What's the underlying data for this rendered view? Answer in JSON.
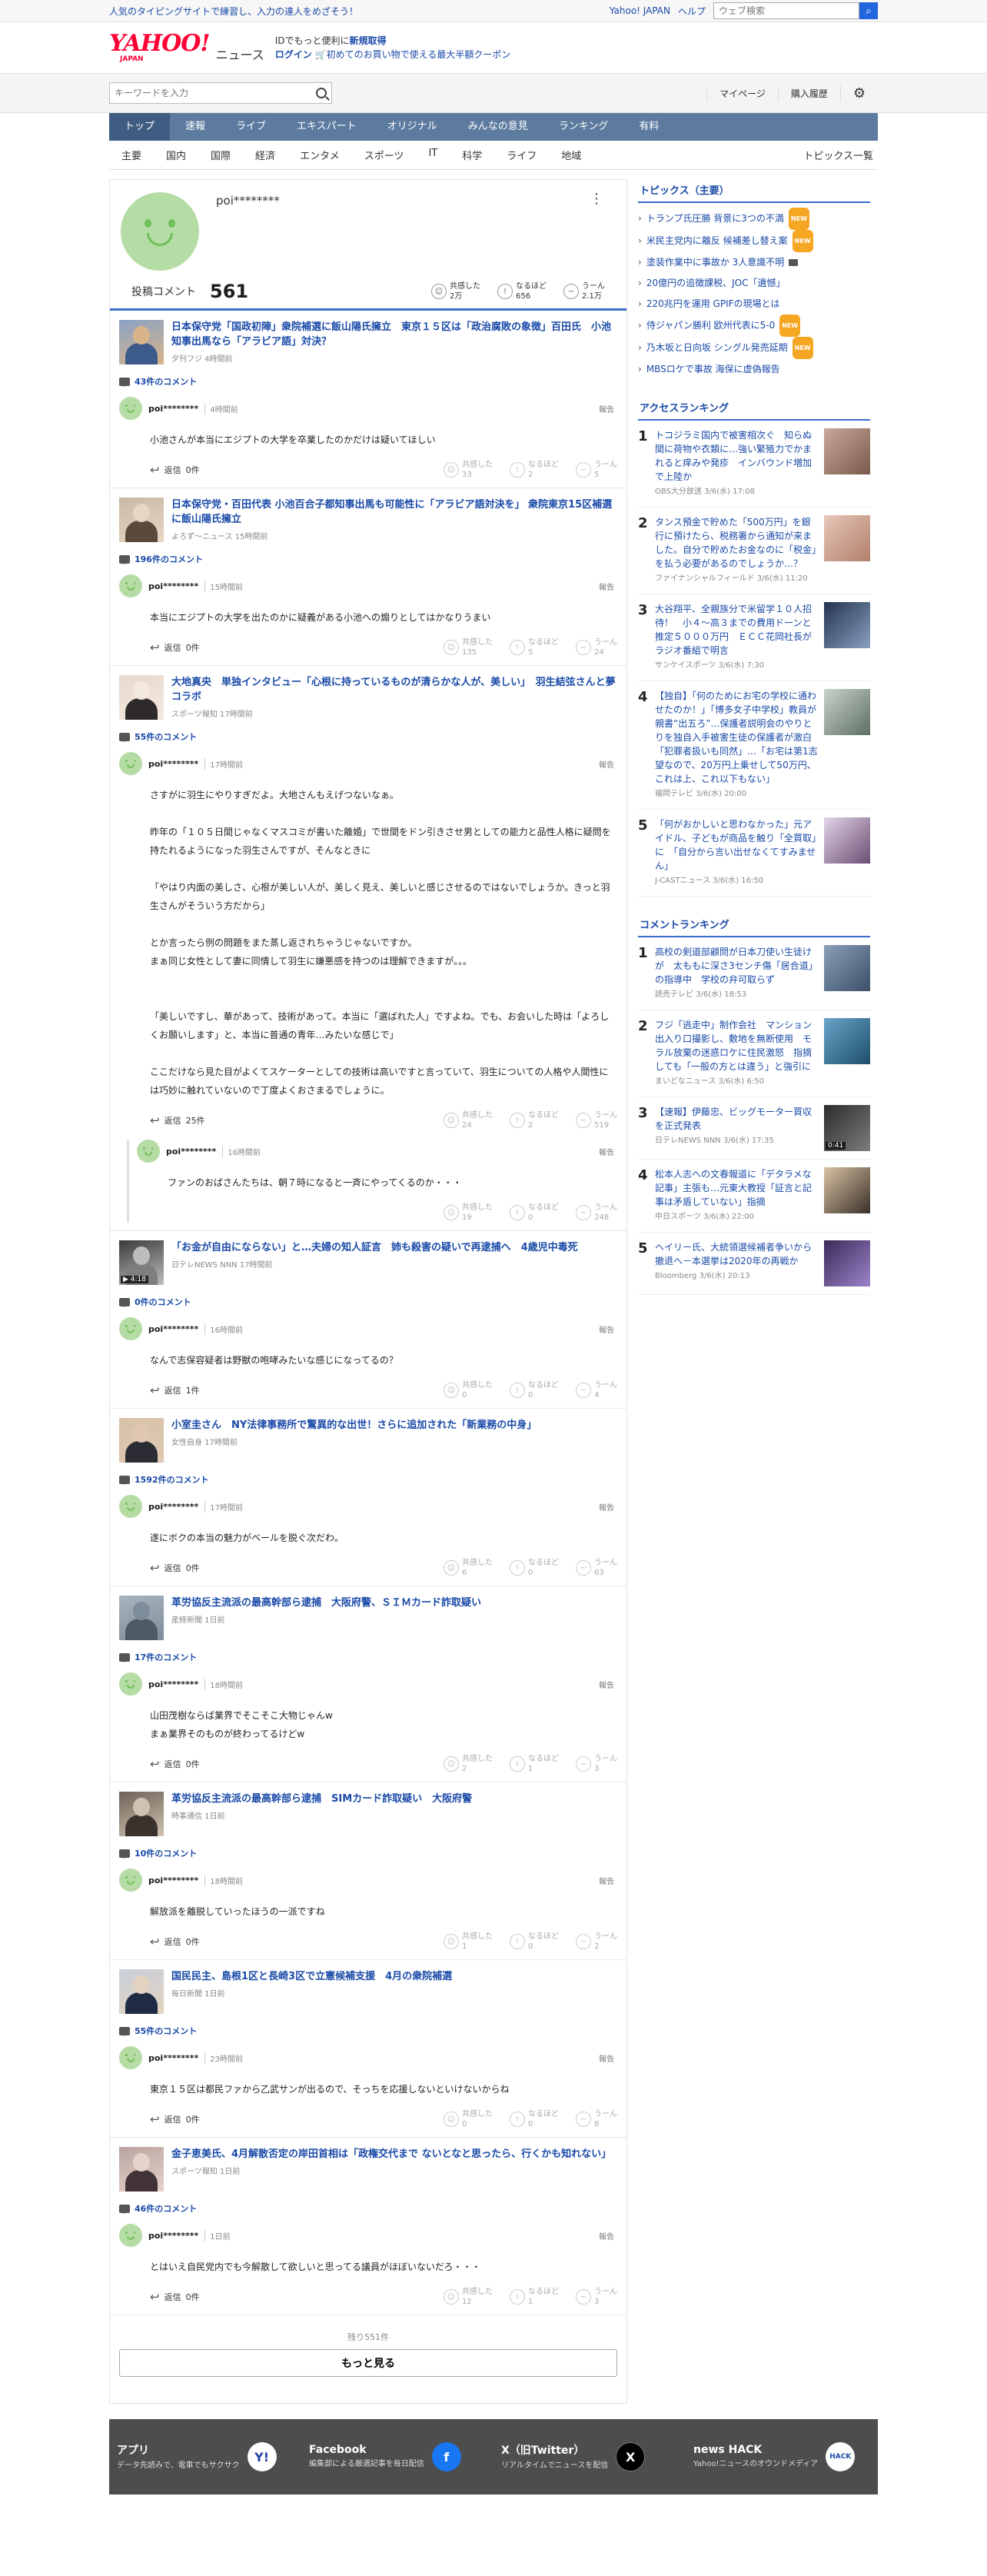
{
  "header": {
    "tagline": "人気のタイピングサイトで練習し、入力の達人をめざそう！",
    "links": [
      "Yahoo! JAPAN",
      "ヘルプ"
    ],
    "web_search_placeholder": "ウェブ検索",
    "logo_text": "YAHOO!",
    "logo_sub": "JAPAN",
    "logo_news": "ニュース",
    "promo_line1_a": "IDでもっと便利に",
    "promo_line1_b": "新規取得",
    "promo_login": "ログイン",
    "promo_line2": "初めてのお買い物で使える最大半額クーポン",
    "keyword_placeholder": "キーワードを入力",
    "mypage": "マイページ",
    "purchase": "購入履歴"
  },
  "gnav": [
    "トップ",
    "速報",
    "ライブ",
    "エキスパート",
    "オリジナル",
    "みんなの意見",
    "ランキング",
    "有料"
  ],
  "subnav": [
    "主要",
    "国内",
    "国際",
    "経済",
    "エンタメ",
    "スポーツ",
    "IT",
    "科学",
    "ライフ",
    "地域"
  ],
  "subnav_all": "トピックス一覧",
  "profile": {
    "name": "poi********",
    "kebab": "⋮",
    "count_label": "投稿コメント",
    "count": "561",
    "reactions": [
      {
        "label": "共感した",
        "value": "2万"
      },
      {
        "label": "なるほど",
        "value": "656"
      },
      {
        "label": "うーん",
        "value": "2.1万"
      }
    ]
  },
  "reply_prefix": "返信",
  "report": "報告",
  "react_labels": [
    "共感した",
    "なるほど",
    "うーん"
  ],
  "entries": [
    {
      "title": "日本保守党「国政初陣」衆院補選に飯山陽氏擁立　東京１５区は「政治腐敗の象徴」百田氏　小池知事出馬なら「アラビア語」対決？",
      "meta": "夕刊フジ 4時間前",
      "ccount": "43件のコメント",
      "comments": [
        {
          "name": "poi********",
          "time": "4時間前",
          "body": "小池さんが本当にエジプトの大学を卒業したのかだけは疑いてほしい",
          "reply": "0件",
          "r": [
            "33",
            "2",
            "5"
          ]
        }
      ]
    },
    {
      "title": "日本保守党・百田代表 小池百合子都知事出馬も可能性に「アラビア語対決を」 衆院東京15区補選に飯山陽氏擁立",
      "meta": "よろず～ニュース 15時間前",
      "ccount": "196件のコメント",
      "comments": [
        {
          "name": "poi********",
          "time": "15時間前",
          "body": "本当にエジプトの大学を出たのかに疑義がある小池への煽りとしてはかなりうまい",
          "reply": "0件",
          "r": [
            "135",
            "5",
            "24"
          ]
        }
      ]
    },
    {
      "title": "大地真央　単独インタビュー「心根に持っているものが清らかな人が、美しい」　羽生結弦さんと夢コラボ",
      "meta": "スポーツ報知 17時間前",
      "ccount": "55件のコメント",
      "comments": [
        {
          "name": "poi********",
          "time": "17時間前",
          "body": "さすがに羽生にやりすぎだよ。大地さんもえげつないなぁ。\n\n昨年の「１０５日間じゃなくマスコミが書いた離婚」で世間をドン引きさせ男としての能力と品性人格に疑問を持たれるようになった羽生さんですが、そんなときに\n\n「やはり内面の美しさ、心根が美しい人が、美しく見え、美しいと感じさせるのではないでしょうか。きっと羽生さんがそういう方だから」\n\nとか言ったら例の問題をまた蒸し返されちゃうじゃないですか。\nまぁ同じ女性として妻に同情して羽生に嫌悪感を持つのは理解できますが。。。\n\n\n「美しいですし、華があって、技術があって。本当に「選ばれた人」ですよね。でも、お会いした時は「よろしくお願いします」と、本当に普通の青年…みたいな感じで」\n\nここだけなら見た目がよくてスケーターとしての技術は高いですと言っていて、羽生についての人格や人間性には巧妙に触れていないので丁度よくおさまるでしょうに。",
          "reply": "25件",
          "r": [
            "24",
            "2",
            "519"
          ]
        },
        {
          "name": "poi********",
          "time": "16時間前",
          "body": "ファンのおばさんたちは、朝７時になると一斉にやってくるのか・・・",
          "reply": null,
          "r": [
            "19",
            "0",
            "248"
          ],
          "thread": true
        }
      ]
    },
    {
      "title": "「お金が自由にならない」と…夫婦の知人証言　姉も殺害の疑いで再逮捕へ　4歳児中毒死",
      "meta": "日テレNEWS NNN 17時間前",
      "ccount": "0件のコメント",
      "video": "4:18",
      "comments": [
        {
          "name": "poi********",
          "time": "16時間前",
          "body": "なんで志保容疑者は野獣の咆哮みたいな感じになってるの？",
          "reply": "1件",
          "r": [
            "0",
            "0",
            "4"
          ]
        }
      ]
    },
    {
      "title": "小室圭さん　NY法律事務所で驚異的な出世！さらに追加された「新業務の中身」",
      "meta": "女性自身 17時間前",
      "ccount": "1592件のコメント",
      "comments": [
        {
          "name": "poi********",
          "time": "17時間前",
          "body": "遂にボクの本当の魅力がベールを脱ぐ次だわ。",
          "reply": "0件",
          "r": [
            "6",
            "0",
            "63"
          ]
        }
      ]
    },
    {
      "title": "革労協反主流派の最高幹部ら逮捕　大阪府警、ＳＩＭカード詐取疑い",
      "meta": "産経新聞 1日前",
      "ccount": "17件のコメント",
      "comments": [
        {
          "name": "poi********",
          "time": "18時間前",
          "body": "山田茂樹ならば業界でそこそこ大物じゃんw\nまぁ業界そのものが終わってるけどw",
          "reply": "0件",
          "r": [
            "2",
            "1",
            "3"
          ]
        }
      ]
    },
    {
      "title": "革労協反主流派の最高幹部ら逮捕　SIMカード詐取疑い　大阪府警",
      "meta": "時事通信 1日前",
      "ccount": "10件のコメント",
      "comments": [
        {
          "name": "poi********",
          "time": "18時間前",
          "body": "解放派を離脱していったほうの一派ですね",
          "reply": "0件",
          "r": [
            "1",
            "0",
            "2"
          ]
        }
      ]
    },
    {
      "title": "国民民主、島根1区と長崎3区で立憲候補支援　4月の衆院補選",
      "meta": "毎日新聞 1日前",
      "ccount": "55件のコメント",
      "comments": [
        {
          "name": "poi********",
          "time": "23時間前",
          "body": "東京１５区は都民ファから乙武サンが出るので、そっちを応援しないといけないからね",
          "reply": "0件",
          "r": [
            "0",
            "0",
            "8"
          ]
        }
      ]
    },
    {
      "title": "金子恵美氏、4月解散否定の岸田首相は「政権交代まで ないとなと思ったら、行くかも知れない」",
      "meta": "スポーツ報知 1日前",
      "ccount": "46件のコメント",
      "comments": [
        {
          "name": "poi********",
          "time": "1日前",
          "body": "とはいえ自民党内でも今解散して欲しいと思ってる議員がほぼいないだろ・・・",
          "reply": "0件",
          "r": [
            "12",
            "1",
            "3"
          ]
        }
      ]
    }
  ],
  "more": {
    "remaining": "残り551件",
    "button": "もっと見る"
  },
  "side": {
    "topics_title": "トピックス（主要）",
    "topics": [
      {
        "t": "トランプ氏圧勝 背景に3つの不満",
        "b": "NEW"
      },
      {
        "t": "米民主党内に離反 候補差し替え案",
        "b": "NEW"
      },
      {
        "t": "塗装作業中に事故か 3人意識不明",
        "b": "cam"
      },
      {
        "t": "20億円の追徴課税、JOC「遺憾」",
        "b": ""
      },
      {
        "t": "220兆円を運用 GPIFの現場とは",
        "b": ""
      },
      {
        "t": "侍ジャパン勝利 欧州代表に5-0",
        "b": "NEW"
      },
      {
        "t": "乃木坂と日向坂 シングル発売延期",
        "b": "NEW"
      },
      {
        "t": "MBSロケで事故 海保に虚偽報告",
        "b": ""
      }
    ],
    "access_title": "アクセスランキング",
    "access": [
      {
        "n": "1",
        "t": "トコジラミ国内で被害相次ぐ　知らぬ間に荷物や衣類に…強い繁殖力でかまれると痒みや発疹　インバウンド増加で上陸か",
        "s": "OBS大分放送 3/6(水) 17:08"
      },
      {
        "n": "2",
        "t": "タンス預金で貯めた「500万円」を銀行に預けたら、税務署から通知が来ました。自分で貯めたお金なのに「税金」を払う必要があるのでしょうか…？",
        "s": "ファイナンシャルフィールド 3/6(水) 11:20"
      },
      {
        "n": "3",
        "t": "大谷翔平、全親族分で米留学１０人招待！　小４～高３までの費用ドーンと推定５０００万円　ＥＣＣ花岡社長がラジオ番組で明言",
        "s": "サンケイスポーツ 3/6(水) 7:30"
      },
      {
        "n": "4",
        "t": "【独自】「何のためにお宅の学校に通わせたのか！」「博多女子中学校」教員が親書“出五ろ”…保護者説明会のやりとりを独自入手被害生徒の保護者が激白「犯罪者扱いも同然」…「お宅は第1志望なので、20万円上乗せして50万円、これは上、これ以下もない」",
        "s": "福岡テレビ 3/6(水) 20:00"
      },
      {
        "n": "5",
        "t": "「何がおかしいと思わなかった」元アイドル、子どもが商品を触り「全買取」に　「自分から言い出せなくてすみません」",
        "s": "J-CASTニュース 3/6(水) 16:50"
      }
    ],
    "comment_title": "コメントランキング",
    "comments": [
      {
        "n": "1",
        "t": "高校の剣道部顧問が日本刀使い生徒けが　太ももに深さ3センチ傷「居合道」の指導中　学校の弁可取らず",
        "s": "読売テレビ 3/6(水) 18:53"
      },
      {
        "n": "2",
        "t": "フジ「逃走中」制作会社　マンション出入り口撮影し、敷地を無断使用　モラル放棄の迷惑ロケに住民激怒　指摘しても「一般の方とは違う」と強引に",
        "s": "まいどなニュース 3/6(水) 6:50"
      },
      {
        "n": "3",
        "t": "【速報】伊藤忠、ビッグモーター買収を正式発表",
        "s": "日テレNEWS NNN 3/6(水) 17:35",
        "video": "0:41"
      },
      {
        "n": "4",
        "t": "松本人志への文春報道に「デタラメな記事」主張も…元東大教授「証言と記事は矛盾していない」指摘",
        "s": "中日スポーツ 3/6(水) 22:00"
      },
      {
        "n": "5",
        "t": "ヘイリー氏、大統領選候補者争いから撤退へ－本選挙は2020年の再戦か",
        "s": "Bloomberg 3/6(水) 20:13"
      }
    ]
  },
  "footer": [
    {
      "title": "アプリ",
      "desc": "データ先読みで、電車でもサクサク",
      "icon": "Y!"
    },
    {
      "title": "Facebook",
      "desc": "編集部による厳選記事を毎日配信",
      "icon": "f"
    },
    {
      "title": "X（旧Twitter）",
      "desc": "リアルタイムでニュースを配信",
      "icon": "X"
    },
    {
      "title": "news HACK",
      "desc": "Yahoo!ニュースのオウンドメディア",
      "icon": "HACK"
    }
  ]
}
